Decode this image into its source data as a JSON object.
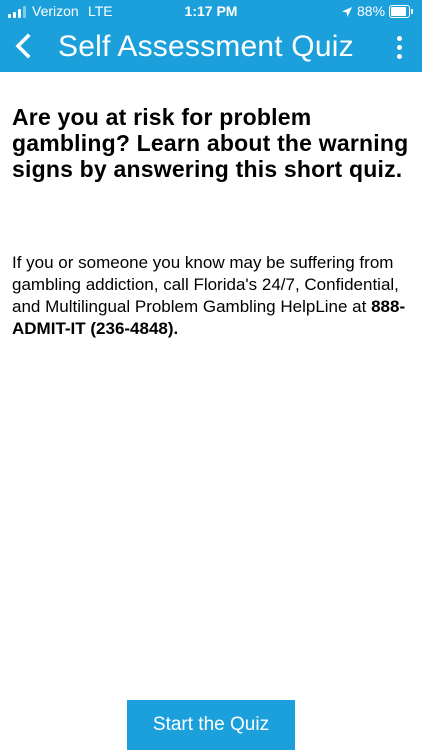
{
  "status_bar": {
    "carrier": "Verizon",
    "network": "LTE",
    "time": "1:17 PM",
    "battery": "88%",
    "icons": [
      "signal-icon",
      "location-icon",
      "battery-icon"
    ]
  },
  "header": {
    "title": "Self Assessment Quiz",
    "back_icon": "back-icon",
    "menu_icon": "overflow-menu-icon",
    "color": "#1ba0db"
  },
  "content": {
    "headline": "Are you at risk for problem gambling? Learn about the warning signs by answering this short quiz.",
    "body_prefix": "If you or someone you know may be suffering from gambling addiction, call Florida's 24/7, Confidential, and Multilingual Problem Gambling HelpLine at ",
    "phone": "888-ADMIT-IT (236-4848)",
    "body_suffix": "."
  },
  "actions": {
    "start_label": "Start the Quiz"
  }
}
